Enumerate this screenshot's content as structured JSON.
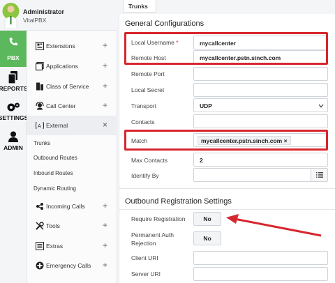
{
  "user": {
    "name": "Administrator",
    "subtitle": "VitalPBX"
  },
  "rail": [
    {
      "label": "PBX",
      "icon": "phone-icon"
    },
    {
      "label": "REPORTS",
      "icon": "reports-icon"
    },
    {
      "label": "SETTINGS",
      "icon": "gears-icon"
    },
    {
      "label": "ADMIN",
      "icon": "user-icon"
    }
  ],
  "menu": {
    "items": [
      {
        "label": "Extensions",
        "icon": "extensions-icon",
        "toggle": "+"
      },
      {
        "label": "Applications",
        "icon": "applications-icon",
        "toggle": "+"
      },
      {
        "label": "Class of Service",
        "icon": "class-of-service-icon",
        "toggle": "+"
      },
      {
        "label": "Call Center",
        "icon": "call-center-icon",
        "toggle": "+"
      },
      {
        "label": "External",
        "icon": "external-icon",
        "toggle": "×"
      }
    ],
    "subitems": [
      "Trunks",
      "Outbound Routes",
      "Inbound Routes",
      "Dynamic Routing"
    ],
    "items2": [
      {
        "label": "Incoming Calls",
        "icon": "incoming-calls-icon",
        "toggle": "+"
      },
      {
        "label": "Tools",
        "icon": "tools-icon",
        "toggle": "+"
      },
      {
        "label": "Extras",
        "icon": "extras-icon",
        "toggle": "+"
      },
      {
        "label": "Emergency Calls",
        "icon": "emergency-calls-icon",
        "toggle": "+"
      }
    ]
  },
  "tab": {
    "label": "Trunks",
    "close": "×"
  },
  "general": {
    "title": "General Configurations",
    "local_username": {
      "label": "Local Username",
      "req": " *",
      "value": "mycallcenter"
    },
    "remote_host": {
      "label": "Remote Host",
      "value": "mycallcenter.pstn.sinch.com"
    },
    "remote_port": {
      "label": "Remote Port",
      "value": ""
    },
    "local_secret": {
      "label": "Local Secret",
      "value": ""
    },
    "transport": {
      "label": "Transport",
      "value": "UDP"
    },
    "contacts": {
      "label": "Contacts",
      "value": ""
    },
    "match": {
      "label": "Match",
      "value": "mycallcenter.pstn.sinch.com",
      "remove": "×"
    },
    "max_contacts": {
      "label": "Max Contacts",
      "value": "2"
    },
    "identify_by": {
      "label": "Identify By",
      "value": ""
    }
  },
  "outbound": {
    "title": "Outbound Registration Settings",
    "require_registration": {
      "label": "Require Registration",
      "value": "No"
    },
    "permanent_auth": {
      "label_line1": "Permanent Auth",
      "label_line2": "Rejection",
      "value": "No"
    },
    "client_uri": {
      "label": "Client URI",
      "value": ""
    },
    "server_uri": {
      "label": "Server URI",
      "value": ""
    }
  },
  "colors": {
    "highlight": "#d7262e",
    "pbx_green": "#5cb85c"
  }
}
